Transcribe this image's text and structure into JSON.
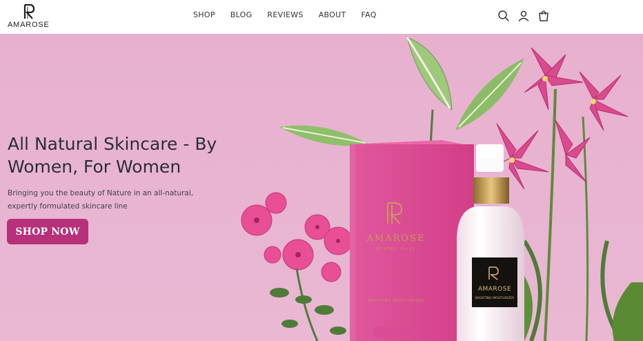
{
  "brand": {
    "name": "AMAROSE"
  },
  "nav": {
    "items": [
      {
        "label": "SHOP"
      },
      {
        "label": "BLOG"
      },
      {
        "label": "REVIEWS"
      },
      {
        "label": "ABOUT"
      },
      {
        "label": "FAQ"
      }
    ]
  },
  "header_icons": [
    "search-icon",
    "account-icon",
    "cart-icon"
  ],
  "hero": {
    "title": "All Natural Skincare - By Women, For Women",
    "subtitle": "Bringing you the beauty of Nature in an all-natural, expertly formulated skincare line",
    "cta_label": "SHOP NOW",
    "box_brand": "AMAROSE",
    "box_location": "BEVERLY HILLS",
    "box_product": "BOOSTING MOISTURIZER",
    "bottle_brand": "AMAROSE",
    "bottle_product": "BOOSTING MOISTURIZER"
  },
  "colors": {
    "hero_bg": "#e8b1cf",
    "cta_bg": "#b7307a",
    "box_pink": "#de4a92",
    "title_text": "#2b2d3c"
  }
}
